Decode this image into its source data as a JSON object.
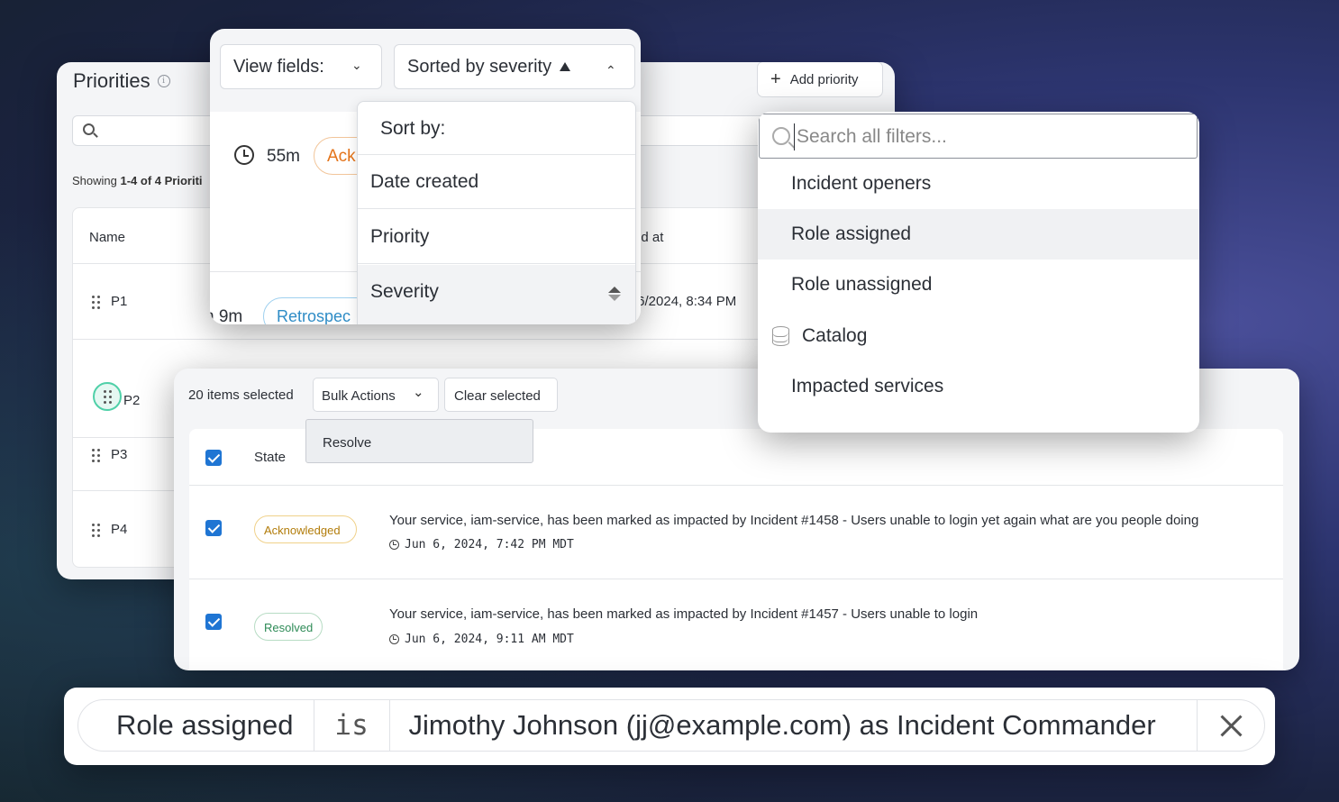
{
  "priorities": {
    "title": "Priorities",
    "add_button": "Add priority",
    "showing_prefix": "Showing ",
    "showing_range": "1-4 of 4 Prioriti",
    "columns": {
      "name": "Name",
      "updated": "ed at"
    },
    "rows": [
      {
        "name": "P1",
        "date": "/6/2024, 8:34 PM"
      },
      {
        "name": "P2"
      },
      {
        "name": "P3"
      },
      {
        "name": "P4"
      }
    ]
  },
  "sort_panel": {
    "view_fields": "View fields:",
    "sorted_by": "Sorted by severity",
    "duration_1": "55m",
    "pill_1": "Ack",
    "duration_2": "h 9m",
    "pill_2": "Retrospec",
    "menu": {
      "heading": "Sort by:",
      "items": [
        "Date created",
        "Priority",
        "Severity"
      ],
      "active": "Severity"
    }
  },
  "filter_search": {
    "placeholder": "Search all filters...",
    "items": [
      "Incident openers",
      "Role assigned",
      "Role unassigned",
      "Catalog",
      "Impacted services"
    ],
    "highlighted": "Role assigned",
    "icons": {
      "Catalog": "database-icon"
    }
  },
  "bulk": {
    "selected_count": "20 items selected",
    "bulk_actions": "Bulk Actions",
    "clear_selected": "Clear selected",
    "resolve": "Resolve",
    "state_header": "State",
    "rows": [
      {
        "state": "Acknowledged",
        "message": "Your service, iam-service, has been marked as impacted by Incident #1458 - Users unable to login yet again what are you people doing",
        "timestamp": "Jun 6, 2024, 7:42 PM MDT",
        "checked": true
      },
      {
        "state": "Resolved",
        "message": "Your service, iam-service, has been marked as impacted by Incident #1457 - Users unable to login",
        "timestamp": "Jun 6, 2024, 9:11 AM MDT",
        "checked": true
      }
    ]
  },
  "filter_chip": {
    "field": "Role assigned",
    "operator": "is",
    "value": "Jimothy Johnson (jj@example.com) as Incident Commander"
  },
  "colors": {
    "accent_blue": "#1f75d3",
    "acknowledged": "#b27c0a",
    "resolved": "#2e8b57",
    "ack_orange": "#e4741a",
    "retro_blue": "#2e8cc6"
  }
}
